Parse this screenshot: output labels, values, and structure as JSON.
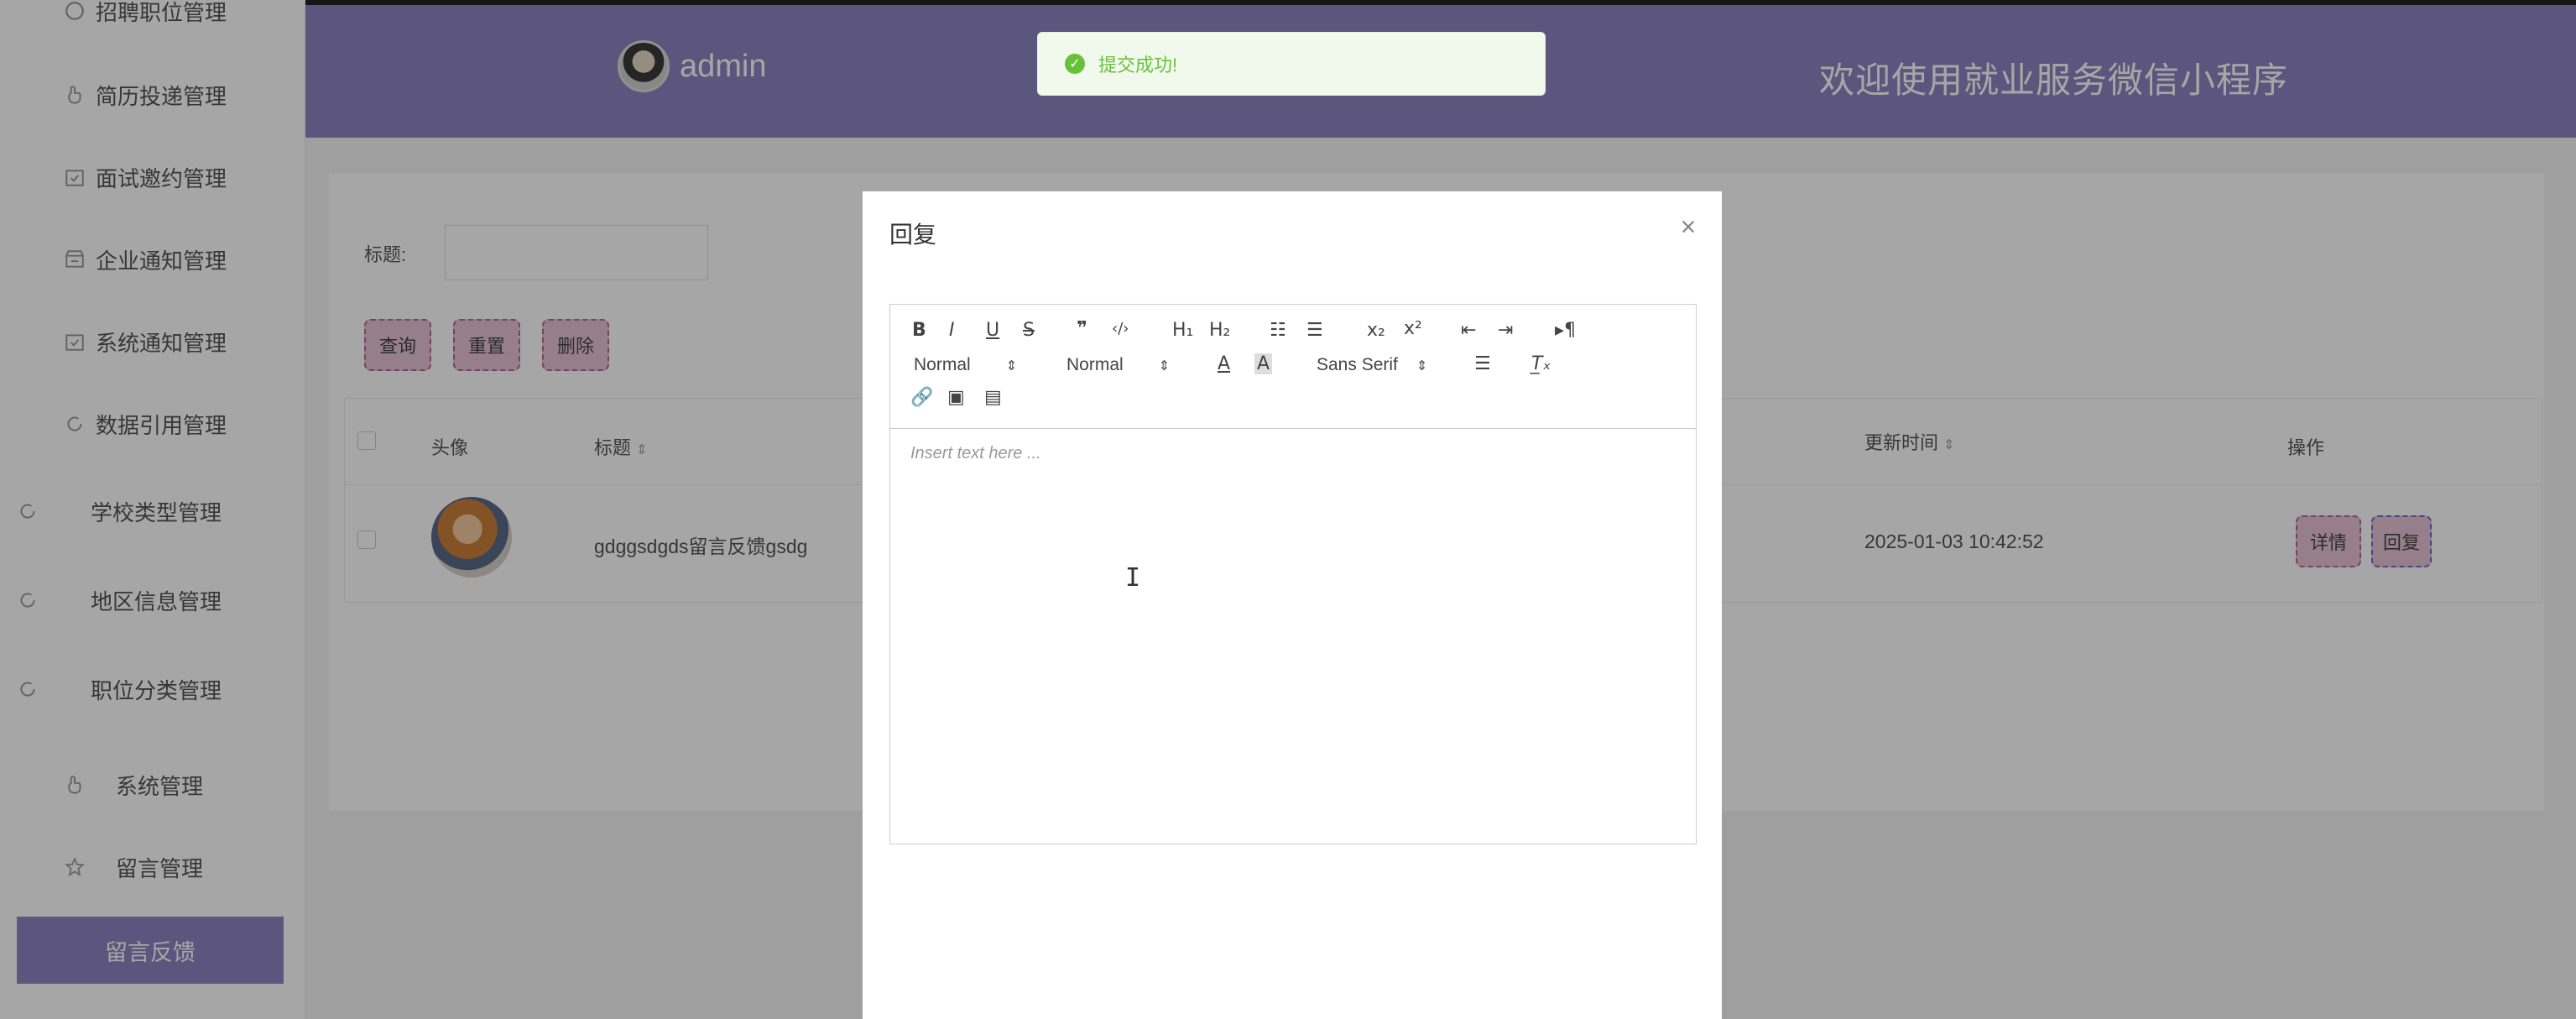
{
  "sidebar": {
    "items": [
      {
        "label": "招聘职位管理",
        "icon": "circle-icon"
      },
      {
        "label": "简历投递管理",
        "icon": "hand-icon"
      },
      {
        "label": "面试邀约管理",
        "icon": "calendar-check-icon"
      },
      {
        "label": "企业通知管理",
        "icon": "store-icon"
      },
      {
        "label": "系统通知管理",
        "icon": "calendar-check-icon"
      },
      {
        "label": "数据引用管理",
        "icon": "refresh-icon"
      },
      {
        "label": "学校类型管理",
        "icon": "refresh-icon"
      },
      {
        "label": "地区信息管理",
        "icon": "refresh-icon"
      },
      {
        "label": "职位分类管理",
        "icon": "refresh-icon"
      },
      {
        "label": "系统管理",
        "icon": "hand-icon"
      },
      {
        "label": "留言管理",
        "icon": "star-icon"
      }
    ],
    "active": "留言反馈"
  },
  "header": {
    "user": "admin",
    "welcome": "欢迎使用就业服务微信小程序",
    "bg_color": "#8e84c2"
  },
  "toast": {
    "message": "提交成功!",
    "color": "#67c23a"
  },
  "search": {
    "label": "标题:",
    "value": ""
  },
  "buttons": {
    "query": "查询",
    "reset": "重置",
    "delete": "删除"
  },
  "table": {
    "headers": {
      "avatar": "头像",
      "title": "标题",
      "updated": "更新时间",
      "actions": "操作"
    },
    "rows": [
      {
        "title": "gdggsdgds留言反馈gsdg",
        "updated": "2025-01-03 10:42:52",
        "detail": "详情",
        "reply": "回复"
      }
    ]
  },
  "dialog": {
    "title": "回复",
    "close": "×",
    "toolbar": {
      "bold": "B",
      "italic": "I",
      "underline": "U",
      "strike": "S",
      "quote": "❞",
      "code": "‹/›",
      "h1": "H₁",
      "h2": "H₂",
      "size": "Normal",
      "header": "Normal",
      "font": "Sans Serif",
      "sub": "x₂",
      "sup": "x²",
      "clean": "T̲ₓ",
      "rtl": "▸¶"
    },
    "placeholder": "Insert text here ..."
  }
}
